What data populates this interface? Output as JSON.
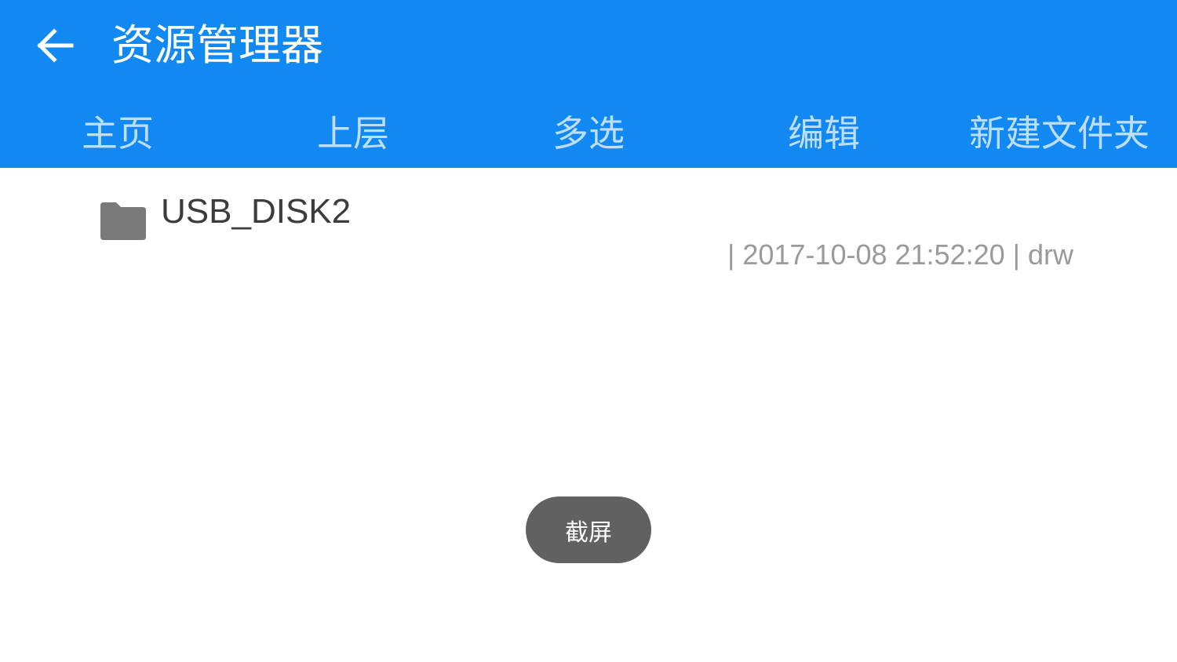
{
  "header": {
    "title": "资源管理器",
    "back_icon": "arrow-left-icon",
    "background_color": "#1289F2"
  },
  "toolbar": {
    "items": [
      {
        "label": "主页"
      },
      {
        "label": "上层"
      },
      {
        "label": "多选"
      },
      {
        "label": "编辑"
      },
      {
        "label": "新建文件夹"
      }
    ]
  },
  "files": [
    {
      "icon": "folder-icon",
      "name": "USB_DISK2",
      "meta": "| 2017-10-08 21:52:20 | drw"
    }
  ],
  "toast": {
    "label": "截屏",
    "background_color": "#616161"
  }
}
